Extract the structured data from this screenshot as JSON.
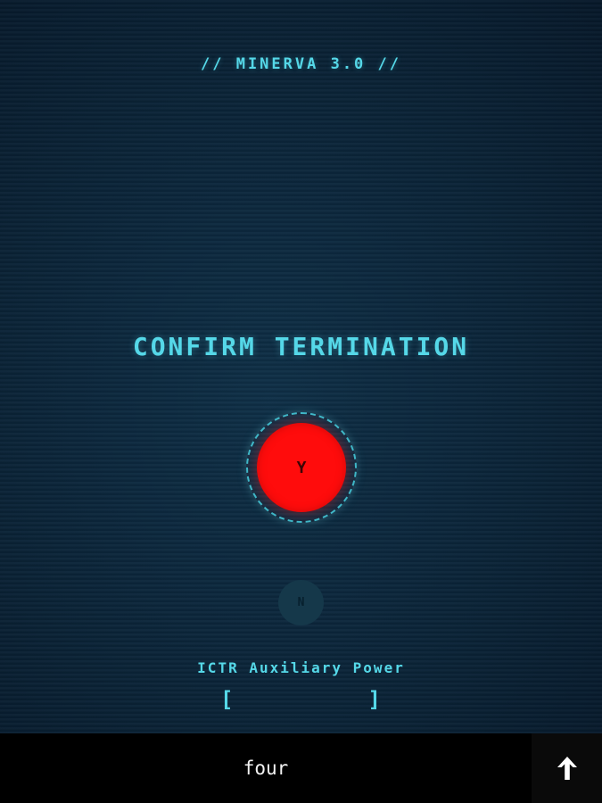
{
  "header": {
    "app_title": "// MINERVA 3.0 //"
  },
  "dialog": {
    "prompt": "CONFIRM TERMINATION",
    "yes_label": "Y",
    "no_label": "N"
  },
  "power": {
    "label": "ICTR Auxiliary Power",
    "bracket_open": "[",
    "bracket_close": "]",
    "level_fraction": 0.0
  },
  "input": {
    "value": "four",
    "send_icon": "arrow-up-icon"
  },
  "colors": {
    "accent": "#55d8e8",
    "yes_button": "#ff0c0c",
    "no_button": "#15384a",
    "background": "#0b2236",
    "input_bar": "#000000"
  }
}
